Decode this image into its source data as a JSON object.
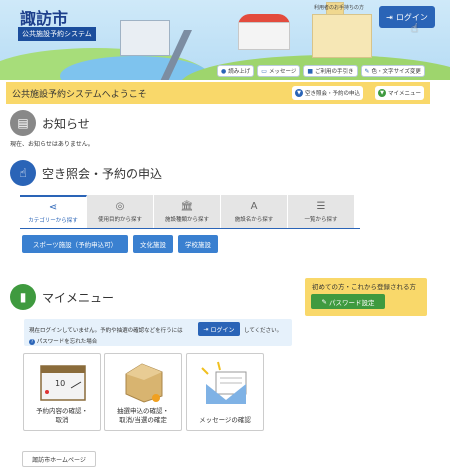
{
  "header": {
    "city_name": "諏訪市",
    "system_name": "公共施設予約システム",
    "notice_link": "利用者のお手持ちの方",
    "login_label": "ログイン",
    "toolbar": [
      {
        "icon": "microphone-icon",
        "label": "読み上げ"
      },
      {
        "icon": "chat-icon",
        "label": "メッセージ"
      },
      {
        "icon": "book-icon",
        "label": "ご利用の手引き"
      },
      {
        "icon": "brush-icon",
        "label": "色・文字サイズ変更"
      }
    ]
  },
  "welcome": {
    "title": "公共施設予約システムへようこそ",
    "search_btn": "空き照会・予約の申込",
    "mymenu_btn": "マイメニュー"
  },
  "news": {
    "title": "お知らせ",
    "text": "現在、お知らせはありません。"
  },
  "search": {
    "title": "空き照会・予約の申込",
    "tabs": [
      {
        "icon": "share-icon",
        "label": "カテゴリーから探す",
        "glyph": "⋖"
      },
      {
        "icon": "target-icon",
        "label": "使用目的から探す",
        "glyph": "◎"
      },
      {
        "icon": "building-icon",
        "label": "施設種類から探す",
        "glyph": "🏛"
      },
      {
        "icon": "letter-a-icon",
        "label": "施設名から探す",
        "glyph": "A"
      },
      {
        "icon": "list-icon",
        "label": "一覧から探す",
        "glyph": "☰"
      }
    ],
    "facility_buttons": [
      "スポーツ施設（予約申込可）",
      "文化施設",
      "学校施設"
    ]
  },
  "mymenu": {
    "title": "マイメニュー",
    "first_time_text": "初めての方・これから登録される方",
    "password_btn": "パスワード設定",
    "login_note_before": "現在ログインしていません。予約や抽選の確認などを行うには",
    "login_note_btn": "ログイン",
    "login_note_after": "してください。",
    "forgot_password": "パスワードを忘れた場合",
    "cards": [
      {
        "icon": "calendar-icon",
        "line1": "予約内容の確認・",
        "line2": "取消"
      },
      {
        "icon": "lottery-icon",
        "line1": "抽選申込の確認・",
        "line2": "取消/当選の確定"
      },
      {
        "icon": "envelope-icon",
        "line1": "メッセージの確認",
        "line2": ""
      }
    ]
  },
  "footer": {
    "homepage_link": "諏訪市ホームページ"
  },
  "colors": {
    "brand_blue": "#2a64b7",
    "yellow": "#f9d86a",
    "green": "#3f9a3f"
  }
}
